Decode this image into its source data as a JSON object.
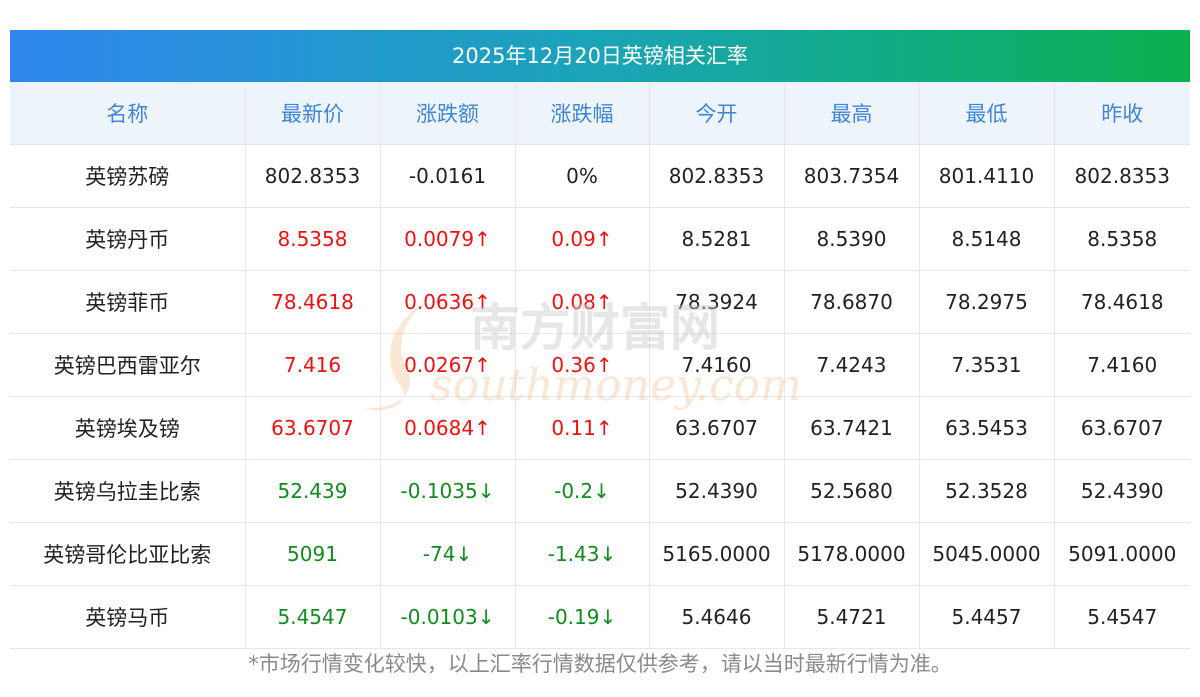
{
  "title": "2025年12月20日英镑相关汇率",
  "columns": [
    "名称",
    "最新价",
    "涨跌额",
    "涨跌幅",
    "今开",
    "最高",
    "最低",
    "昨收"
  ],
  "rows": [
    {
      "name": "英镑苏磅",
      "latest": "802.8353",
      "change": "-0.0161",
      "pct": "0%",
      "open": "802.8353",
      "high": "803.7354",
      "low": "801.4110",
      "prev": "802.8353",
      "dir": "flat"
    },
    {
      "name": "英镑丹币",
      "latest": "8.5358",
      "change": "0.0079↑",
      "pct": "0.09↑",
      "open": "8.5281",
      "high": "8.5390",
      "low": "8.5148",
      "prev": "8.5358",
      "dir": "up"
    },
    {
      "name": "英镑菲币",
      "latest": "78.4618",
      "change": "0.0636↑",
      "pct": "0.08↑",
      "open": "78.3924",
      "high": "78.6870",
      "low": "78.2975",
      "prev": "78.4618",
      "dir": "up"
    },
    {
      "name": "英镑巴西雷亚尔",
      "latest": "7.416",
      "change": "0.0267↑",
      "pct": "0.36↑",
      "open": "7.4160",
      "high": "7.4243",
      "low": "7.3531",
      "prev": "7.4160",
      "dir": "up"
    },
    {
      "name": "英镑埃及镑",
      "latest": "63.6707",
      "change": "0.0684↑",
      "pct": "0.11↑",
      "open": "63.6707",
      "high": "63.7421",
      "low": "63.5453",
      "prev": "63.6707",
      "dir": "up"
    },
    {
      "name": "英镑乌拉圭比索",
      "latest": "52.439",
      "change": "-0.1035↓",
      "pct": "-0.2↓",
      "open": "52.4390",
      "high": "52.5680",
      "low": "52.3528",
      "prev": "52.4390",
      "dir": "down"
    },
    {
      "name": "英镑哥伦比亚比索",
      "latest": "5091",
      "change": "-74↓",
      "pct": "-1.43↓",
      "open": "5165.0000",
      "high": "5178.0000",
      "low": "5045.0000",
      "prev": "5091.0000",
      "dir": "down"
    },
    {
      "name": "英镑马币",
      "latest": "5.4547",
      "change": "-0.0103↓",
      "pct": "-0.19↓",
      "open": "5.4646",
      "high": "5.4721",
      "low": "5.4457",
      "prev": "5.4547",
      "dir": "down"
    }
  ],
  "watermark": {
    "cn": "南方财富网",
    "en": "southmoney.com"
  },
  "footnote": "*市场行情变化较快，以上汇率行情数据仅供参考，请以当时最新行情为准。",
  "colors": {
    "up": "#f01010",
    "down": "#118c1c",
    "header_text": "#3f86d8",
    "title_grad_start": "#2f86ee",
    "title_grad_end": "#0ab14e"
  }
}
